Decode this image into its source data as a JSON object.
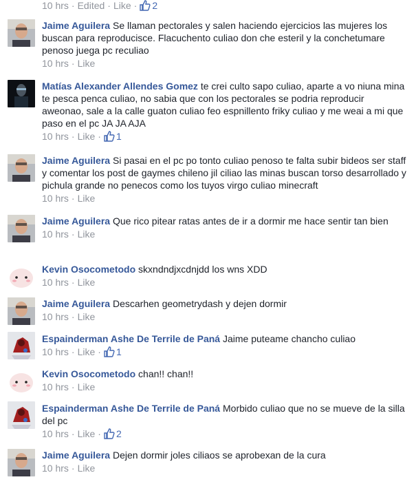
{
  "colors": {
    "author": "#365899",
    "text": "#1d2129",
    "meta": "#90949c",
    "thumb": "#4267b2"
  },
  "top_meta": {
    "time": "10 hrs",
    "edited": "Edited",
    "like": "Like",
    "likes": "2"
  },
  "comments": [
    {
      "avatar": "jaime-avatar",
      "author": "Jaime Aguilera",
      "text": "Se llaman pectorales y salen haciendo ejercicios las mujeres los buscan para reproducisce. Flacuchento culiao don che esteril y la conchetumare penoso juega pc reculiao",
      "time": "10 hrs",
      "like": "Like",
      "likes": ""
    },
    {
      "avatar": "matias-avatar",
      "author": "Matías Alexander Allendes Gomez",
      "text": "te crei culto sapo culiao, aparte a vo niuna mina te pesca penca culiao, no sabia que con los pectorales se podria reproducir aweonao, sale a la calle guaton culiao feo espnillento friky culiao y me weai a mi que paso en el pc JA JA AJA",
      "time": "10 hrs",
      "like": "Like",
      "likes": "1"
    },
    {
      "avatar": "jaime-avatar",
      "author": "Jaime Aguilera",
      "text": "Si pasai en el pc po tonto culiao penoso te falta subir bideos ser staff y comentar los post de gaymes chileno jil ciliao las minas buscan torso desarrollado y pichula grande no penecos como los tuyos virgo culiao minecraft",
      "time": "10 hrs",
      "like": "Like",
      "likes": ""
    },
    {
      "avatar": "jaime-avatar",
      "author": "Jaime Aguilera",
      "text": "Que rico pitear ratas antes de ir a dormir me hace sentir tan bien",
      "time": "10 hrs",
      "like": "Like",
      "likes": ""
    },
    {
      "avatar": "kevin-avatar",
      "author": "Kevin Osocometodo",
      "text": "skxndndjxcdnjdd los wns XDD",
      "time": "10 hrs",
      "like": "Like",
      "likes": ""
    },
    {
      "avatar": "jaime-avatar",
      "author": "Jaime Aguilera",
      "text": "Descarhen geometrydash y dejen dormir",
      "time": "10 hrs",
      "like": "Like",
      "likes": ""
    },
    {
      "avatar": "espainderman-avatar",
      "author": "Espainderman Ashe De Terrile de Paná",
      "text": "Jaime puteame chancho culiao",
      "time": "10 hrs",
      "like": "Like",
      "likes": "1"
    },
    {
      "avatar": "kevin-avatar",
      "author": "Kevin Osocometodo",
      "text": "chan!! chan!!",
      "time": "10 hrs",
      "like": "Like",
      "likes": ""
    },
    {
      "avatar": "espainderman-avatar",
      "author": "Espainderman Ashe De Terrile de Paná",
      "text": "Morbido culiao que no se mueve de la silla del pc",
      "time": "10 hrs",
      "like": "Like",
      "likes": "2"
    },
    {
      "avatar": "jaime-avatar",
      "author": "Jaime Aguilera",
      "text": "Dejen dormir joles ciliaos se aprobexan de la cura",
      "time": "10 hrs",
      "like": "Like",
      "likes": ""
    }
  ]
}
